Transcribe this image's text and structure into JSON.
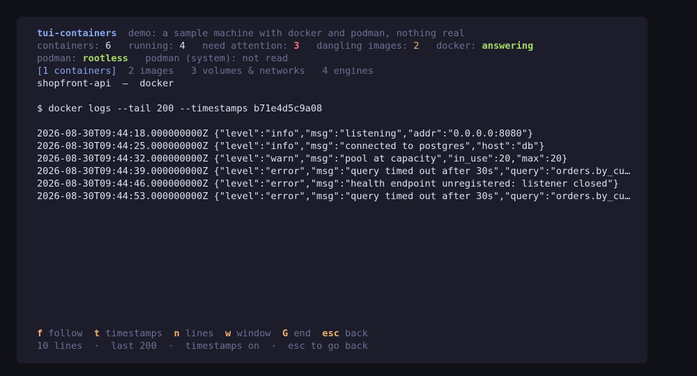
{
  "header": {
    "app_name": "tui-containers",
    "tagline": "demo: a sample machine with docker and podman, nothing real"
  },
  "status": {
    "containers_label": "containers:",
    "containers_value": "6",
    "running_label": "running:",
    "running_value": "4",
    "attention_label": "need attention:",
    "attention_value": "3",
    "dangling_label": "dangling images:",
    "dangling_value": "2",
    "docker_label": "docker:",
    "docker_value": "answering"
  },
  "engines": {
    "podman_label": "podman:",
    "podman_value": "rootless",
    "podman_system_label": "podman (system):",
    "podman_system_value": "not read"
  },
  "tabs": [
    {
      "label": "[1 containers]",
      "selected": true
    },
    {
      "label": "2 images",
      "selected": false
    },
    {
      "label": "3 volumes & networks",
      "selected": false
    },
    {
      "label": "4 engines",
      "selected": false
    }
  ],
  "context": {
    "container": "shopfront-api",
    "separator": "—",
    "engine": "docker"
  },
  "command": "$ docker logs --tail 200 --timestamps b71e4d5c9a08",
  "logs": [
    "2026-08-30T09:44:18.000000000Z {\"level\":\"info\",\"msg\":\"listening\",\"addr\":\"0.0.0.0:8080\"}",
    "2026-08-30T09:44:25.000000000Z {\"level\":\"info\",\"msg\":\"connected to postgres\",\"host\":\"db\"}",
    "2026-08-30T09:44:32.000000000Z {\"level\":\"warn\",\"msg\":\"pool at capacity\",\"in_use\":20,\"max\":20}",
    "2026-08-30T09:44:39.000000000Z {\"level\":\"error\",\"msg\":\"query timed out after 30s\",\"query\":\"orders.by_customer\"}",
    "2026-08-30T09:44:46.000000000Z {\"level\":\"error\",\"msg\":\"health endpoint unregistered: listener closed\"}",
    "2026-08-30T09:44:53.000000000Z {\"level\":\"error\",\"msg\":\"query timed out after 30s\",\"query\":\"orders.by_customer\"}"
  ],
  "keys": [
    {
      "key": "f",
      "label": "follow"
    },
    {
      "key": "t",
      "label": "timestamps"
    },
    {
      "key": "n",
      "label": "lines"
    },
    {
      "key": "w",
      "label": "window"
    },
    {
      "key": "G",
      "label": "end"
    },
    {
      "key": "esc",
      "label": "back"
    }
  ],
  "footer_status": [
    "10 lines",
    "last 200",
    "timestamps on",
    "esc to go back"
  ],
  "footer_separator": "·",
  "colors": {
    "background": "#1c1c2a",
    "accent": "#8aa6ec",
    "warning": "#f0b06a",
    "danger": "#f07183",
    "ok": "#a6d96a"
  }
}
